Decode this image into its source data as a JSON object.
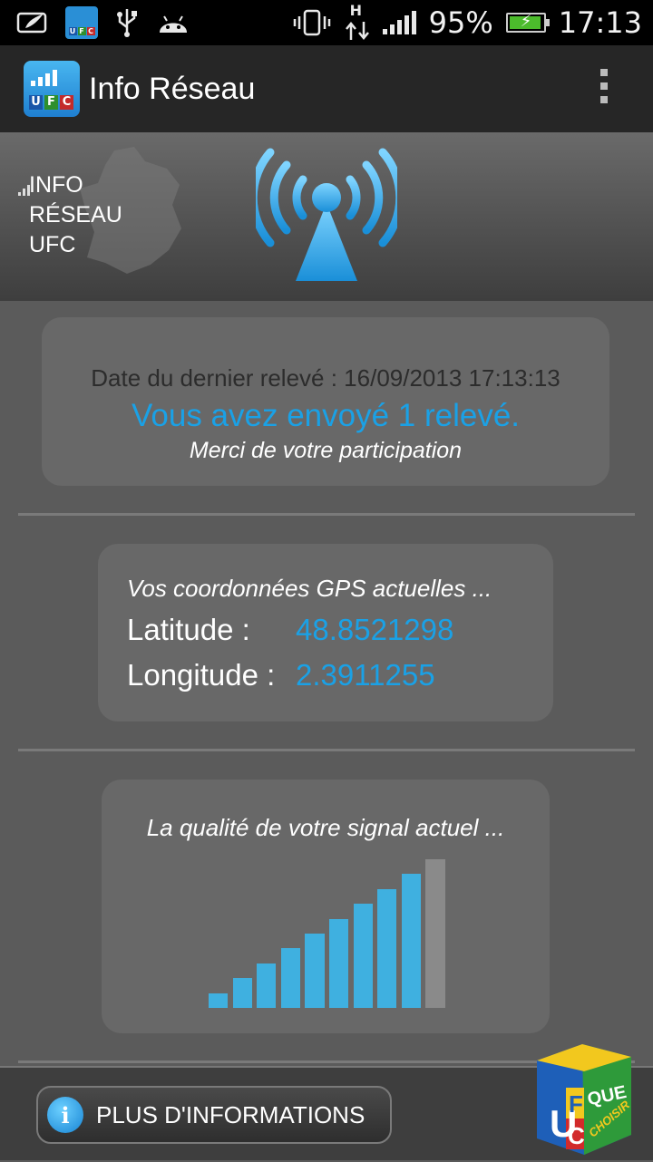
{
  "status_bar": {
    "battery_percent": "95%",
    "time": "17:13",
    "network_type": "H",
    "icons": [
      "screenshot-icon",
      "ufc-app-icon",
      "usb-icon",
      "android-debug-icon",
      "vibrate-icon",
      "data-transfer-icon",
      "signal-strength-icon",
      "battery-charging-icon"
    ],
    "mini_logo_letters": [
      "U",
      "F",
      "C"
    ]
  },
  "action_bar": {
    "title": "Info Réseau",
    "icon_letters": [
      "U",
      "F",
      "C"
    ],
    "overflow_icon": "overflow-menu-icon"
  },
  "banner": {
    "lines": [
      "INFO",
      "RÉSEAU",
      "UFC"
    ],
    "tower_icon": "antenna-tower-icon",
    "map_icon": "france-map-icon"
  },
  "last_report": {
    "date_line": "Date du dernier relevé : 16/09/2013 17:13:13",
    "sent_line": "Vous avez envoyé 1 relevé.",
    "thanks_line": "Merci de votre participation"
  },
  "gps": {
    "title": "Vos coordonnées GPS actuelles ...",
    "latitude_label": "Latitude :",
    "latitude_value": "48.8521298",
    "longitude_label": "Longitude :",
    "longitude_value": "2.3911255"
  },
  "signal": {
    "title": "La qualité de votre signal actuel ...",
    "total_bars": 10,
    "active_bars": 9,
    "active_color": "#3fb0e0",
    "inactive_color": "#8a8a8a"
  },
  "footer": {
    "more_button_label": "PLUS D'INFORMATIONS",
    "info_icon_glyph": "i",
    "brand_logo": {
      "letters_left": [
        "U",
        "F",
        "C"
      ],
      "text_right": [
        "QUE",
        "CHOISIR"
      ]
    }
  },
  "colors": {
    "accent_blue": "#1aa1e6",
    "background": "#5b5b5b",
    "card": "#686868"
  }
}
